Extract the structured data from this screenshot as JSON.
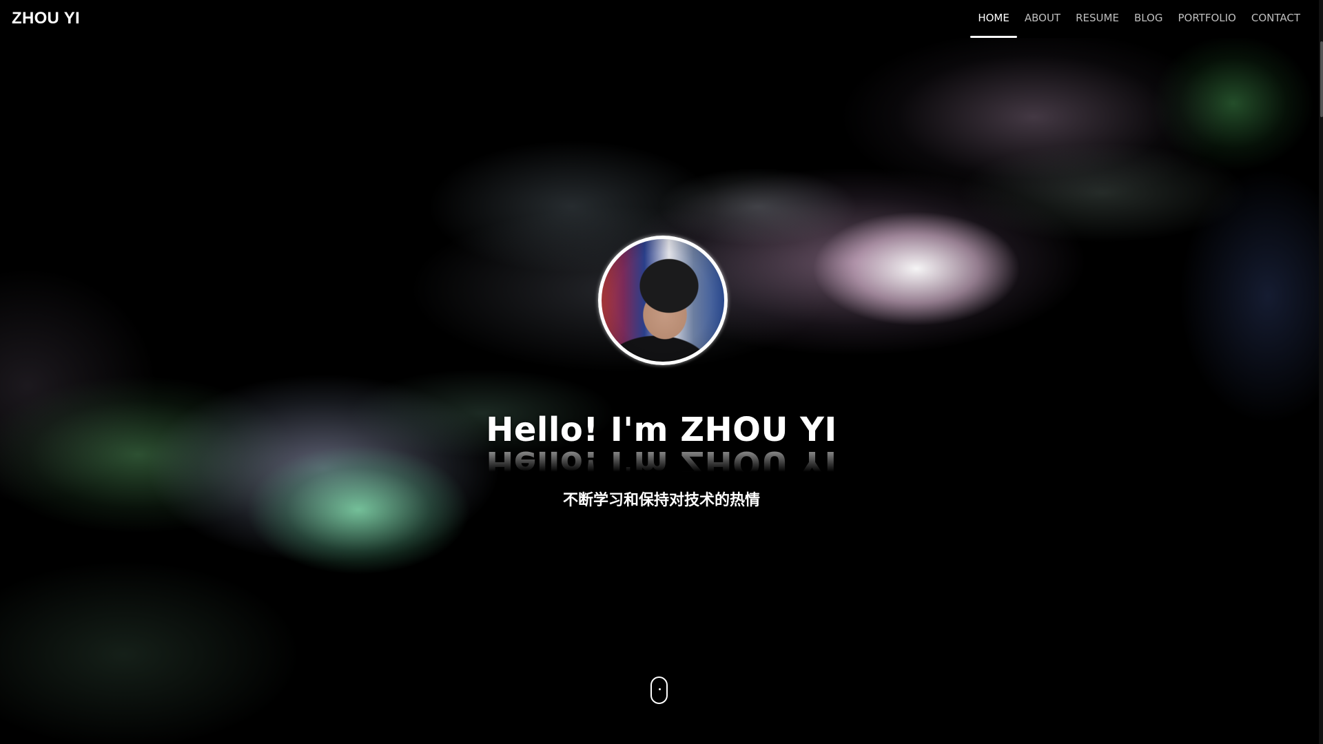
{
  "brand": {
    "title": "ZHOU YI"
  },
  "nav": {
    "items": [
      {
        "label": "HOME",
        "active": true
      },
      {
        "label": "ABOUT",
        "active": false
      },
      {
        "label": "RESUME",
        "active": false
      },
      {
        "label": "BLOG",
        "active": false
      },
      {
        "label": "PORTFOLIO",
        "active": false
      },
      {
        "label": "CONTACT",
        "active": false
      }
    ]
  },
  "hero": {
    "title": "Hello! I'm ZHOU YI",
    "subtitle": "不断学习和保持对技术的热情",
    "scroll_icon": "mouse-scroll-icon"
  },
  "colors": {
    "background": "#000000",
    "text": "#ffffff",
    "nav_inactive": "#bfbfbf",
    "smoke_green": "#8cf0b9",
    "smoke_pink": "#ebc8e1"
  }
}
